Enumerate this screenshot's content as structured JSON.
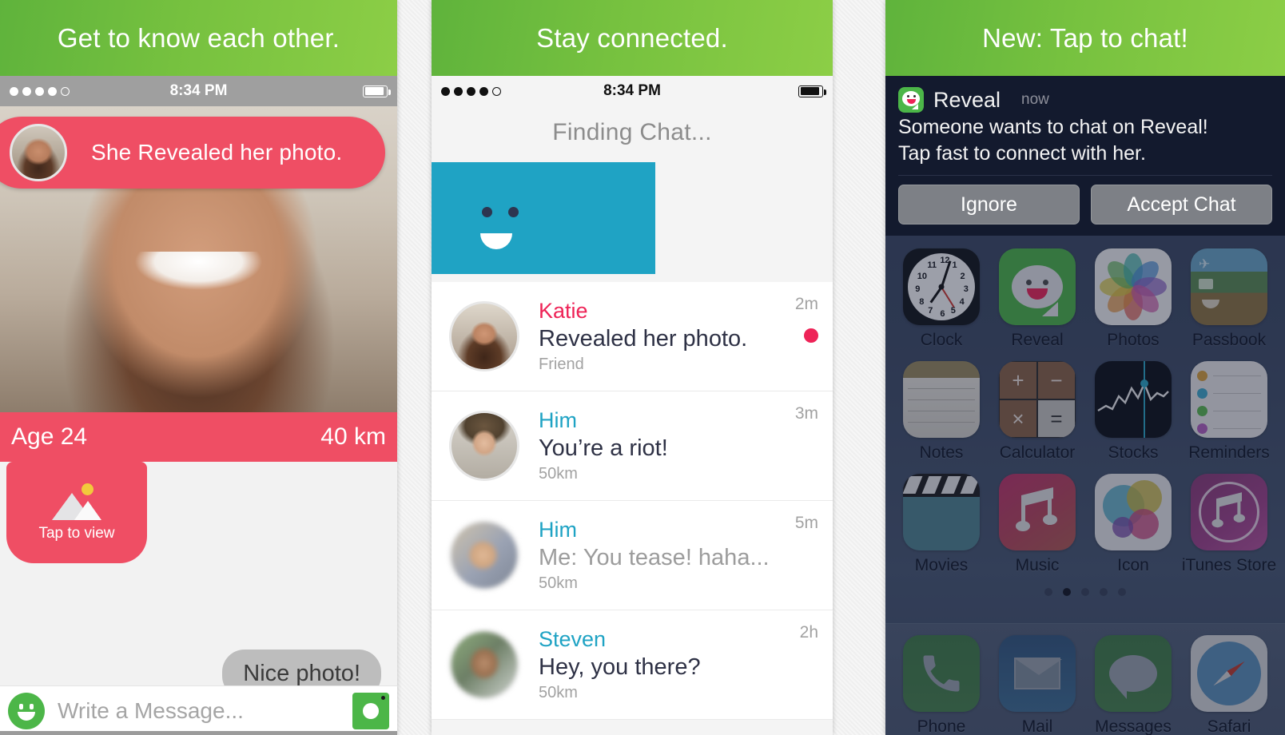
{
  "panels": [
    {
      "promo": "Get to know each other.",
      "status": {
        "time": "8:34 PM",
        "signal_dots": 5,
        "signal_filled": 4
      },
      "toast": {
        "text": "She Revealed her photo.",
        "avatar": "katie-avatar"
      },
      "profile": {
        "age": "Age 24",
        "distance": "40 km"
      },
      "photo_card": {
        "label": "Tap to view",
        "icon": "image-placeholder-icon"
      },
      "messages": [
        {
          "from": "me",
          "text": "Nice photo!"
        }
      ],
      "composer": {
        "placeholder": "Write a Message...",
        "emoji_icon": "smiley-icon",
        "camera_icon": "camera-icon"
      }
    },
    {
      "promo": "Stay connected.",
      "status": {
        "time": "8:34 PM",
        "signal_dots": 5,
        "signal_filled": 4
      },
      "title": "Finding Chat...",
      "hero": {
        "icon": "smiley-face-banner",
        "color": "#1fa3c4"
      },
      "chats": [
        {
          "name": "Katie",
          "name_color": "pink",
          "message": "Revealed her photo.",
          "message_muted": false,
          "sub": "Friend",
          "time": "2m",
          "unread": true,
          "avatar": "katie-avatar"
        },
        {
          "name": "Him",
          "name_color": "blue",
          "message": "You’re a riot!",
          "message_muted": false,
          "sub": "50km",
          "time": "3m",
          "unread": false,
          "avatar": "him-avatar-1"
        },
        {
          "name": "Him",
          "name_color": "blue",
          "message": "Me: You tease! haha...",
          "message_muted": true,
          "sub": "50km",
          "time": "5m",
          "unread": false,
          "avatar": "him-avatar-2"
        },
        {
          "name": "Steven",
          "name_color": "blue",
          "message": "Hey, you there?",
          "message_muted": false,
          "sub": "50km",
          "time": "2h",
          "unread": false,
          "avatar": "steven-avatar"
        }
      ]
    },
    {
      "promo": "New: Tap to chat!",
      "notification": {
        "app": "Reveal",
        "time": "now",
        "line1": "Someone wants to chat on Reveal!",
        "line2": "Tap fast to connect with her.",
        "ignore_label": "Ignore",
        "accept_label": "Accept Chat",
        "icon": "reveal-app-icon"
      },
      "home": {
        "apps": [
          {
            "label": "Clock",
            "icon": "clock-icon"
          },
          {
            "label": "Reveal",
            "icon": "reveal-icon"
          },
          {
            "label": "Photos",
            "icon": "photos-icon"
          },
          {
            "label": "Passbook",
            "icon": "passbook-icon"
          },
          {
            "label": "Notes",
            "icon": "notes-icon"
          },
          {
            "label": "Calculator",
            "icon": "calculator-icon"
          },
          {
            "label": "Stocks",
            "icon": "stocks-icon"
          },
          {
            "label": "Reminders",
            "icon": "reminders-icon"
          },
          {
            "label": "Movies",
            "icon": "movies-icon"
          },
          {
            "label": "Music",
            "icon": "music-icon"
          },
          {
            "label": "Icon",
            "icon": "icon-app-icon"
          },
          {
            "label": "iTunes Store",
            "icon": "itunes-store-icon"
          }
        ],
        "page_count": 5,
        "active_page": 2,
        "dock": [
          {
            "label": "Phone",
            "icon": "phone-icon"
          },
          {
            "label": "Mail",
            "icon": "mail-icon"
          },
          {
            "label": "Messages",
            "icon": "messages-icon"
          },
          {
            "label": "Safari",
            "icon": "safari-icon"
          }
        ]
      }
    }
  ],
  "colors": {
    "promo_green": "#76c13f",
    "pink": "#ef4e64",
    "accent_pink": "#ee2357",
    "teal": "#1fa3c4",
    "reveal_green": "#4cb648",
    "notif_bg": "#131a2e"
  },
  "calc_keys": [
    "+",
    "−",
    "×",
    "="
  ],
  "clock_numbers": [
    "12",
    "1",
    "2",
    "3",
    "4",
    "5",
    "6",
    "7",
    "8",
    "9",
    "10",
    "11"
  ]
}
